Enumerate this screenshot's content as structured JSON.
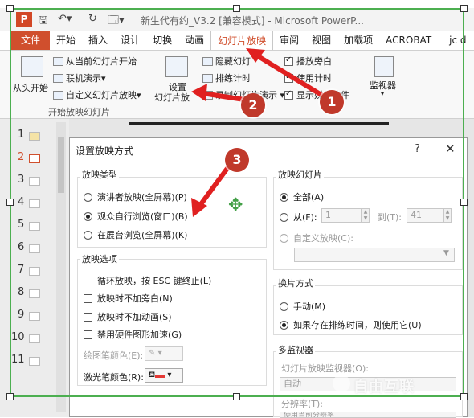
{
  "app": {
    "icon_letter": "P",
    "title": "新生代有约_V3.2 [兼容模式] - Microsoft PowerP...",
    "quick_access": [
      "save-icon",
      "undo-icon",
      "redo-icon",
      "slideshow-icon"
    ]
  },
  "ribbon_tabs": [
    "文件",
    "开始",
    "插入",
    "设计",
    "切换",
    "动画",
    "幻灯片放映",
    "审阅",
    "视图",
    "加载项",
    "ACROBAT"
  ],
  "active_tab": "幻灯片放映",
  "user": "jc d",
  "ribbon": {
    "from_start": "从头开始",
    "from_current": "从当前幻灯片开始",
    "online": "联机演示",
    "custom": "自定义幻灯片放映",
    "group_start": "开始放映幻灯片",
    "setup_line1": "设置",
    "setup_line2": "幻灯片放",
    "hide_slide": "隐藏幻灯",
    "rehearse": "排练计时",
    "record": "录制幻灯片演示",
    "play_narration": "播放旁白",
    "use_timing": "使用计时",
    "show_media": "显示媒体控件",
    "monitors": "监视器"
  },
  "slides": [
    "1",
    "2",
    "3",
    "4",
    "5",
    "6",
    "7",
    "8",
    "9",
    "10",
    "11"
  ],
  "dialog": {
    "title": "设置放映方式",
    "help": "?",
    "close": "✕",
    "show_type_label": "放映类型",
    "show_types": [
      "演讲者放映(全屏幕)(P)",
      "观众自行浏览(窗口)(B)",
      "在展台浏览(全屏幕)(K)"
    ],
    "show_options_label": "放映选项",
    "options": [
      "循环放映，按 ESC 键终止(L)",
      "放映时不加旁白(N)",
      "放映时不加动画(S)",
      "禁用硬件图形加速(G)"
    ],
    "pen_color_label": "绘图笔颜色(E):",
    "laser_color_label": "激光笔颜色(R):",
    "slides_label": "放映幻灯片",
    "all": "全部(A)",
    "from": "从(F):",
    "from_value": "1",
    "to": "到(T):",
    "to_value": "41",
    "custom_show": "自定义放映(C):",
    "advance_label": "换片方式",
    "manual": "手动(M)",
    "use_timings": "如果存在排练时间，则使用它(U)",
    "multi_monitor_label": "多监视器",
    "monitor_label": "幻灯片放映监视器(O):",
    "monitor_value": "自动",
    "resolution_label": "分辨率(T):",
    "resolution_value": "使用当前分辨率"
  },
  "annotations": [
    "1",
    "2",
    "3"
  ],
  "watermark": "自由互联",
  "colors": {
    "accent": "#d04f2d",
    "arrow": "#e02020",
    "frame": "#4caf50",
    "laser": "#e53935"
  }
}
